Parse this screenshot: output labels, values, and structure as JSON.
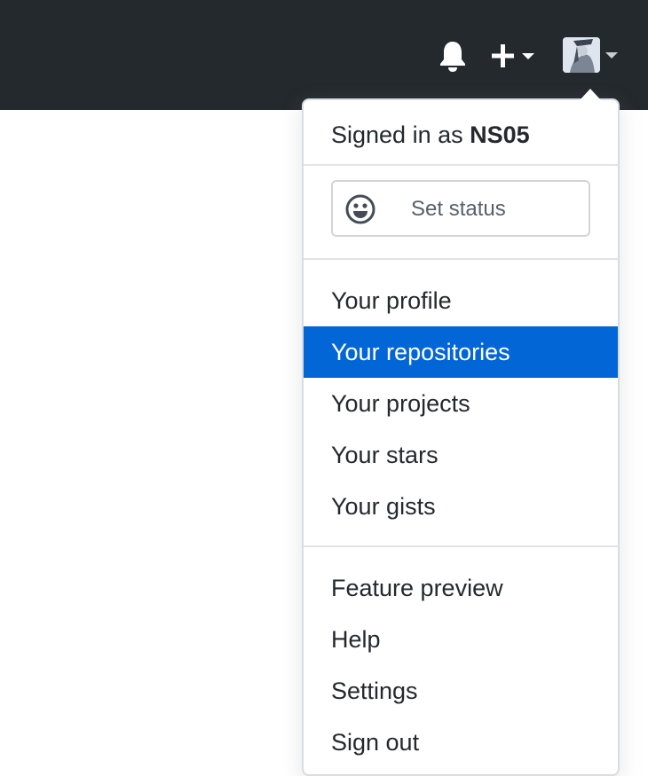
{
  "header": {
    "notifications_icon": "bell-icon",
    "create_icon": "plus-icon",
    "avatar_icon": "user-avatar"
  },
  "user_menu": {
    "signed_in_prefix": "Signed in as",
    "username": "NS05",
    "set_status_label": "Set status",
    "set_status_icon": "smiley-icon",
    "section1": [
      {
        "label": "Your profile",
        "active": false
      },
      {
        "label": "Your repositories",
        "active": true
      },
      {
        "label": "Your projects",
        "active": false
      },
      {
        "label": "Your stars",
        "active": false
      },
      {
        "label": "Your gists",
        "active": false
      }
    ],
    "section2": [
      {
        "label": "Feature preview"
      },
      {
        "label": "Help"
      },
      {
        "label": "Settings"
      },
      {
        "label": "Sign out"
      }
    ]
  },
  "colors": {
    "header_bg": "#24292e",
    "active_item_bg": "#0366d6"
  }
}
